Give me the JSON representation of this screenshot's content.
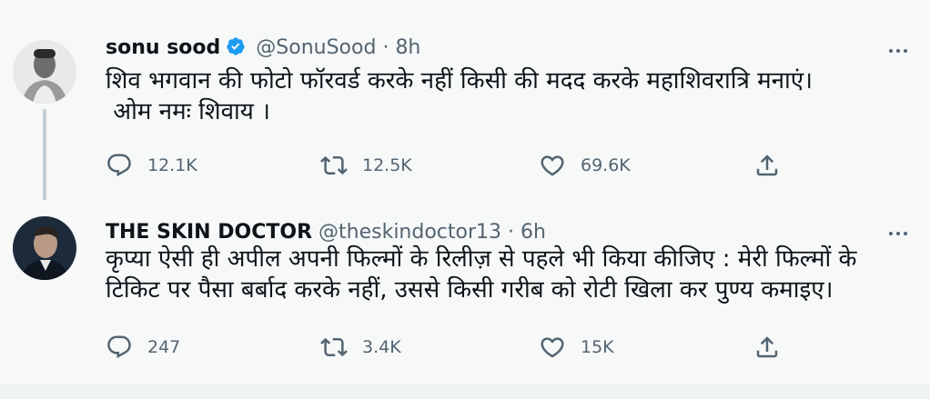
{
  "tweets": [
    {
      "name": "sonu sood",
      "handle": "@SonuSood",
      "separator": "·",
      "time": "8h",
      "verified": true,
      "text_lines": [
        "शिव भगवान की फोटो फॉरवर्ड करके नहीं किसी की मदद करके महाशिवरात्रि मनाएं।",
        " ओम नमः शिवाय ।"
      ],
      "replies": "12.1K",
      "retweets": "12.5K",
      "likes": "69.6K"
    },
    {
      "name": "THE SKIN DOCTOR",
      "handle": "@theskindoctor13",
      "separator": "·",
      "time": "6h",
      "verified": false,
      "text_lines": [
        "कृप्या ऐसी ही अपील अपनी फिल्मों के रिलीज़ से पहले भी किया कीजिए : मेरी फिल्मों के",
        "टिकिट पर पैसा बर्बाद करके नहीं, उससे किसी गरीब को रोटी खिला कर पुण्य कमाइए।"
      ],
      "replies": "247",
      "retweets": "3.4K",
      "likes": "15K"
    }
  ],
  "icons": {
    "verified": "verified-badge-icon",
    "more": "more-icon",
    "reply": "reply-icon",
    "retweet": "retweet-icon",
    "like": "like-icon",
    "share": "share-icon"
  },
  "colors": {
    "background": "#f7f9f9",
    "text": "#0f1419",
    "secondary_text": "#536471",
    "verified": "#1d9bf0",
    "thread_line": "#c4cfd6"
  }
}
